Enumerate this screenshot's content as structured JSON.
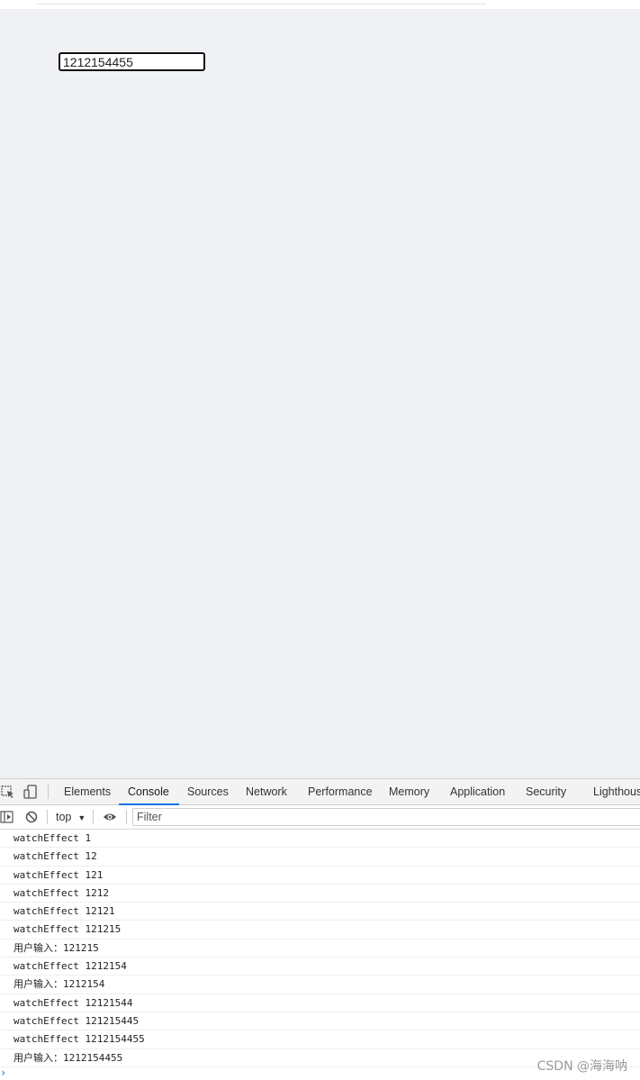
{
  "page": {
    "input_value": "1212154455"
  },
  "devtools": {
    "tabs": [
      "Elements",
      "Console",
      "Sources",
      "Network",
      "Performance",
      "Memory",
      "Application",
      "Security",
      "Lighthouse"
    ],
    "active_tab": "Console",
    "context": "top",
    "filter_placeholder": "Filter",
    "console": [
      "watchEffect 1",
      "watchEffect 12",
      "watchEffect 121",
      "watchEffect 1212",
      "watchEffect 12121",
      "watchEffect 121215",
      "用户输入：121215",
      "watchEffect 1212154",
      "用户输入：1212154",
      "watchEffect 12121544",
      "watchEffect 121215445",
      "watchEffect 1212154455",
      "用户输入：1212154455"
    ],
    "prompt_symbol": "›"
  },
  "watermark": "CSDN @海海呐",
  "colors": {
    "viewport_bg": "#f0f1f5",
    "accent": "#1a73e8"
  }
}
